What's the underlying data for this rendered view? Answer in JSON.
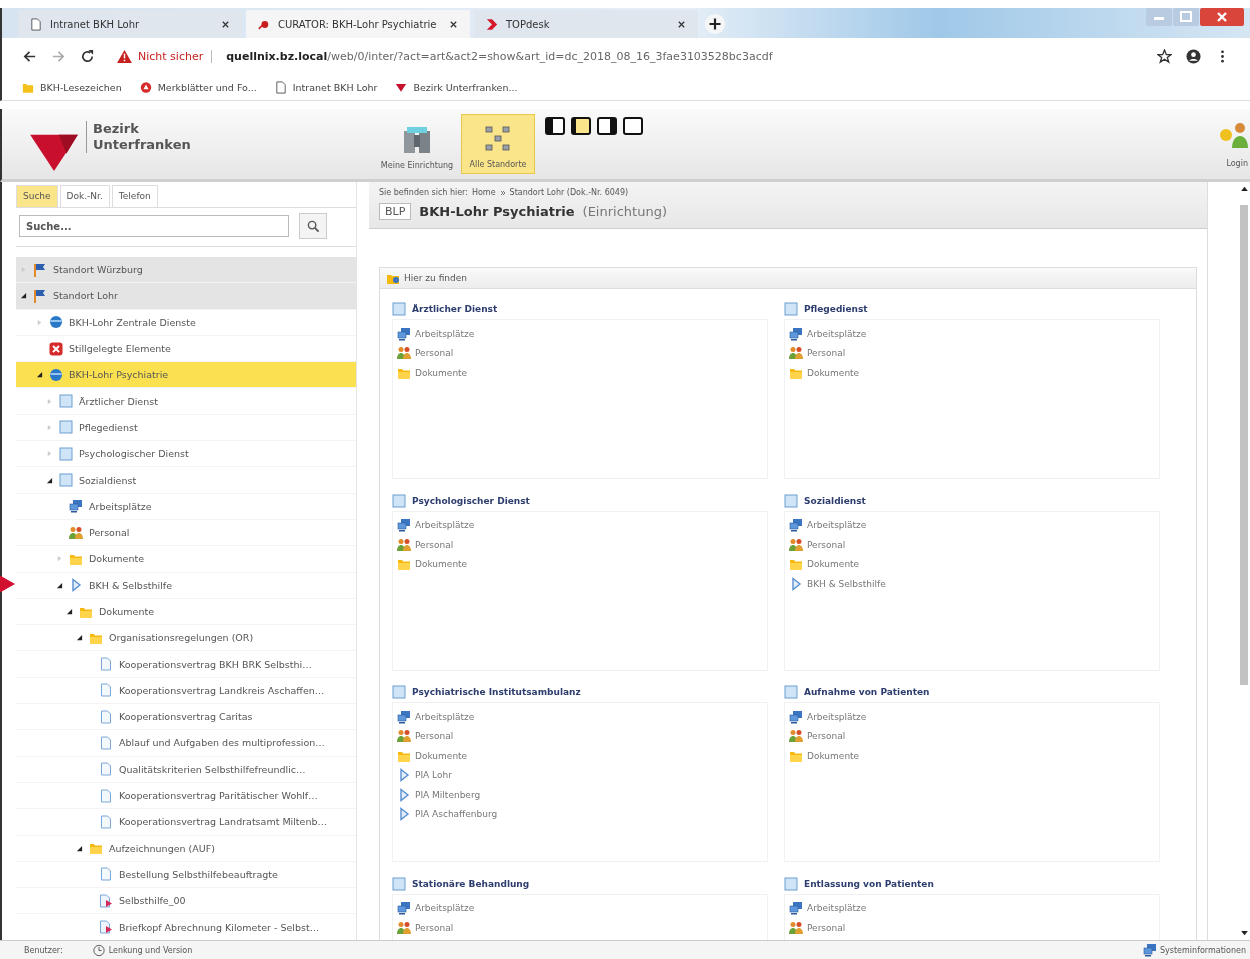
{
  "browser": {
    "tabs": [
      {
        "title": "Intranet BKH Lohr",
        "selected": false
      },
      {
        "title": "CURATOR: BKH-Lohr Psychiatrie",
        "selected": true
      },
      {
        "title": "TOPdesk",
        "selected": false
      }
    ],
    "security": "Nicht sicher",
    "host": "quellnix.bz.local",
    "path": "/web/0/inter/?act=art&act2=show&art_id=dc_2018_08_16_3fae3103528bc3acdf",
    "bookmarks": [
      "BKH-Lesezeichen",
      "Merkblätter und Fo...",
      "Intranet BKH Lohr",
      "Bezirk Unterfranken..."
    ]
  },
  "header": {
    "logo": "Bezirk Unterfranken",
    "views": [
      {
        "label": "Meine Einrichtung",
        "selected": false
      },
      {
        "label": "Alle Standorte",
        "selected": true
      }
    ],
    "layouts": [
      {
        "kind": "left",
        "selected": false
      },
      {
        "kind": "narrow",
        "selected": true
      },
      {
        "kind": "right",
        "selected": false
      },
      {
        "kind": "empty",
        "selected": false
      }
    ],
    "login": "Login"
  },
  "sidebar": {
    "tabs": [
      {
        "label": "Suche",
        "selected": true
      },
      {
        "label": "Dok.-Nr.",
        "selected": false
      },
      {
        "label": "Telefon",
        "selected": false
      }
    ],
    "search": {
      "placeholder": "Suche..."
    },
    "tree": [
      {
        "label": "Standort Würzburg",
        "kind": "flag",
        "expanded": false,
        "selected": false
      },
      {
        "label": "Standort Lohr",
        "kind": "flag",
        "expanded": true,
        "selected": false,
        "children": [
          {
            "label": "BKH-Lohr Zentrale Dienste",
            "kind": "globe",
            "expanded": false,
            "selected": false
          },
          {
            "label": "Stillgelegte Elemente",
            "kind": "redx",
            "selected": false
          },
          {
            "label": "BKH-Lohr Psychiatrie",
            "kind": "globe",
            "expanded": true,
            "selected": true,
            "children": [
              {
                "label": "Ärztlicher Dienst",
                "kind": "dept",
                "expanded": false,
                "selected": false
              },
              {
                "label": "Pflegedienst",
                "kind": "dept",
                "expanded": false,
                "selected": false
              },
              {
                "label": "Psychologischer Dienst",
                "kind": "dept",
                "expanded": false,
                "selected": false
              },
              {
                "label": "Sozialdienst",
                "kind": "dept",
                "expanded": true,
                "selected": false,
                "children": [
                  {
                    "label": "Arbeitsplätze",
                    "kind": "workplace",
                    "selected": false
                  },
                  {
                    "label": "Personal",
                    "kind": "people",
                    "selected": false
                  },
                  {
                    "label": "Dokumente",
                    "kind": "folder",
                    "expanded": false,
                    "selected": false
                  },
                  {
                    "label": "BKH & Selbsthilfe",
                    "kind": "link",
                    "expanded": true,
                    "selected": false,
                    "children": [
                      {
                        "label": "Dokumente",
                        "kind": "folder",
                        "expanded": true,
                        "selected": false,
                        "children": [
                          {
                            "label": "Organisationsregelungen (OR)",
                            "kind": "folder",
                            "expanded": true,
                            "selected": false,
                            "children": [
                              {
                                "label": "Kooperationsvertrag BKH BRK Selbsthi…",
                                "kind": "doc",
                                "selected": false
                              },
                              {
                                "label": "Kooperationsvertrag Landkreis Aschaffen…",
                                "kind": "doc",
                                "selected": false
                              },
                              {
                                "label": "Kooperationsvertrag Caritas",
                                "kind": "doc",
                                "selected": false
                              },
                              {
                                "label": "Ablauf und Aufgaben des multiprofession…",
                                "kind": "doc",
                                "selected": false
                              },
                              {
                                "label": "Qualitätskriterien Selbsthilfefreundlic…",
                                "kind": "doc",
                                "selected": false
                              },
                              {
                                "label": "Kooperationsvertrag Paritätischer Wohlf…",
                                "kind": "doc",
                                "selected": false
                              },
                              {
                                "label": "Kooperationsvertrag Landratsamt Miltenb…",
                                "kind": "doc",
                                "selected": false
                              }
                            ]
                          },
                          {
                            "label": "Aufzeichnungen (AUF)",
                            "kind": "folder",
                            "expanded": true,
                            "selected": false,
                            "children": [
                              {
                                "label": "Bestellung Selbsthilfebeauftragte",
                                "kind": "doc",
                                "selected": false
                              },
                              {
                                "label": "Selbsthilfe_00",
                                "kind": "docarrow",
                                "selected": false
                              },
                              {
                                "label": "Briefkopf Abrechnung Kilometer - Selbst…",
                                "kind": "docarrow",
                                "selected": false
                              }
                            ]
                          }
                        ]
                      }
                    ]
                  }
                ]
              }
            ]
          }
        ]
      }
    ]
  },
  "content": {
    "breadcrumb_label": "Sie befinden sich hier:",
    "breadcrumb": [
      "Home",
      "Standort Lohr (Dok.-Nr. 6049)"
    ],
    "abbreviation": "BLP",
    "title": "BKH-Lohr Psychiatrie",
    "type": "(Einrichtung)",
    "panel_title": "Hier zu finden",
    "cards": [
      {
        "title": "Ärztlicher Dienst",
        "items": [
          {
            "label": "Arbeitsplätze",
            "kind": "workplace"
          },
          {
            "label": "Personal",
            "kind": "people"
          },
          {
            "label": "Dokumente",
            "kind": "folder"
          }
        ]
      },
      {
        "title": "Pflegedienst",
        "items": [
          {
            "label": "Arbeitsplätze",
            "kind": "workplace"
          },
          {
            "label": "Personal",
            "kind": "people"
          },
          {
            "label": "Dokumente",
            "kind": "folder"
          }
        ]
      },
      {
        "title": "Psychologischer Dienst",
        "items": [
          {
            "label": "Arbeitsplätze",
            "kind": "workplace"
          },
          {
            "label": "Personal",
            "kind": "people"
          },
          {
            "label": "Dokumente",
            "kind": "folder"
          }
        ]
      },
      {
        "title": "Sozialdienst",
        "items": [
          {
            "label": "Arbeitsplätze",
            "kind": "workplace"
          },
          {
            "label": "Personal",
            "kind": "people"
          },
          {
            "label": "Dokumente",
            "kind": "folder"
          },
          {
            "label": "BKH & Selbsthilfe",
            "kind": "link"
          }
        ]
      },
      {
        "title": "Psychiatrische Institutsambulanz",
        "items": [
          {
            "label": "Arbeitsplätze",
            "kind": "workplace"
          },
          {
            "label": "Personal",
            "kind": "people"
          },
          {
            "label": "Dokumente",
            "kind": "folder"
          },
          {
            "label": "PIA Lohr",
            "kind": "link"
          },
          {
            "label": "PIA Miltenberg",
            "kind": "link"
          },
          {
            "label": "PIA Aschaffenburg",
            "kind": "link"
          }
        ]
      },
      {
        "title": "Aufnahme von Patienten",
        "items": [
          {
            "label": "Arbeitsplätze",
            "kind": "workplace"
          },
          {
            "label": "Personal",
            "kind": "people"
          },
          {
            "label": "Dokumente",
            "kind": "folder"
          }
        ]
      },
      {
        "title": "Stationäre Behandlung",
        "items": [
          {
            "label": "Arbeitsplätze",
            "kind": "workplace"
          },
          {
            "label": "Personal",
            "kind": "people"
          }
        ]
      },
      {
        "title": "Entlassung von Patienten",
        "items": [
          {
            "label": "Arbeitsplätze",
            "kind": "workplace"
          },
          {
            "label": "Personal",
            "kind": "people"
          }
        ]
      }
    ]
  },
  "status_bar": {
    "user_label": "Benutzer:",
    "version": "Lenkung und Version",
    "system": "Systeminformationen"
  }
}
